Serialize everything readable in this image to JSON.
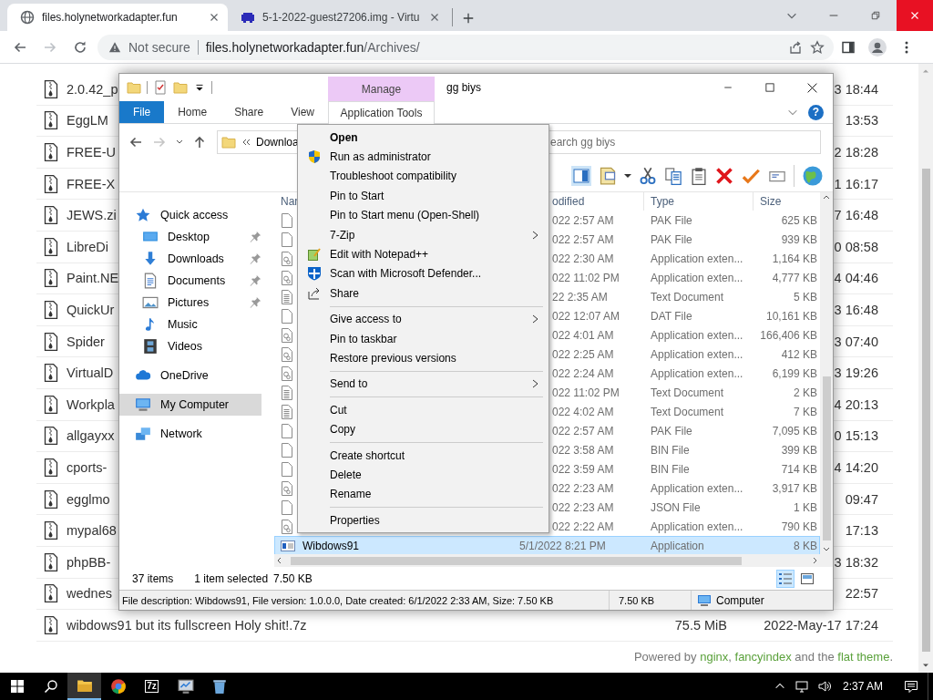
{
  "browser": {
    "tabs": [
      {
        "kind": "site",
        "title": "files.holynetworkadapter.fun",
        "selected": true
      },
      {
        "kind": "app",
        "title": "5-1-2022-guest27206.img - Virtu",
        "selected": false
      }
    ],
    "address": {
      "security": "Not secure",
      "host": "files.holynetworkadapter.fun",
      "path": "/Archives/"
    }
  },
  "listing": {
    "rows": [
      {
        "name": "2.0.42_p",
        "date": "3 18:44"
      },
      {
        "name": "EggLM",
        "date": "13:53"
      },
      {
        "name": "FREE-U",
        "date": "2 18:28"
      },
      {
        "name": "FREE-X",
        "date": "1 16:17"
      },
      {
        "name": "JEWS.zi",
        "date": "7 16:48"
      },
      {
        "name": "LibreDi",
        "date": "0 08:58"
      },
      {
        "name": "Paint.NE",
        "date": "4 04:46"
      },
      {
        "name": "QuickUr",
        "date": "3 16:48"
      },
      {
        "name": "Spider",
        "date": "3 07:40"
      },
      {
        "name": "VirtualD",
        "date": "3 19:26"
      },
      {
        "name": "Workpla",
        "date": "4 20:13"
      },
      {
        "name": "allgayxx",
        "date": "0 15:13"
      },
      {
        "name": "cports-",
        "date": "4 14:20"
      },
      {
        "name": "egglmo",
        "date": "09:47"
      },
      {
        "name": "mypal68",
        "date": "17:13"
      },
      {
        "name": "phpBB-",
        "date": "3 18:32"
      },
      {
        "name": "wednes",
        "date": "22:57"
      },
      {
        "name": "wibdows91 but its fullscreen Holy shit!.7z",
        "size": "75.5 MiB",
        "date": "2022-May-17 17:24"
      }
    ],
    "footer": [
      {
        "kind": "text",
        "text": "Powered by "
      },
      {
        "kind": "link",
        "text": "nginx"
      },
      {
        "kind": "text",
        "text": ", "
      },
      {
        "kind": "link",
        "text": "fancyindex"
      },
      {
        "kind": "text",
        "text": " and the "
      },
      {
        "kind": "link",
        "text": "flat theme"
      },
      {
        "kind": "text",
        "text": "."
      }
    ]
  },
  "explorer": {
    "title": "gg biys",
    "context_tab": {
      "group": "Manage",
      "label": "Application Tools",
      "selected": true
    },
    "ribbon_tabs": [
      {
        "kind": "file",
        "label": "File",
        "selected": false
      },
      {
        "kind": "tab",
        "label": "Home",
        "selected": false
      },
      {
        "kind": "tab",
        "label": "Share",
        "selected": false
      },
      {
        "kind": "tab",
        "label": "View",
        "selected": false
      }
    ],
    "help": "?",
    "address": {
      "crumb": "Downloa"
    },
    "search": {
      "placeholder": "earch gg biys"
    },
    "nav": [
      {
        "kind": "star",
        "label": "Quick access",
        "selected": false,
        "children": [
          {
            "kind": "desktop",
            "label": "Desktop",
            "pinned": true,
            "selected": false
          },
          {
            "kind": "download",
            "label": "Downloads",
            "pinned": true,
            "selected": false
          },
          {
            "kind": "documents",
            "label": "Documents",
            "pinned": true,
            "selected": false
          },
          {
            "kind": "pictures",
            "label": "Pictures",
            "pinned": true,
            "selected": false
          },
          {
            "kind": "music",
            "label": "Music",
            "pinned": false,
            "selected": false
          },
          {
            "kind": "videos",
            "label": "Videos",
            "pinned": false,
            "selected": false
          }
        ]
      },
      {
        "kind": "cloud",
        "label": "OneDrive",
        "selected": false
      },
      {
        "kind": "computer",
        "label": "My Computer",
        "selected": true
      },
      {
        "kind": "network",
        "label": "Network",
        "selected": false
      }
    ],
    "columns": [
      "Nar",
      "odified",
      "Type",
      "Size"
    ],
    "files": [
      {
        "kind": "blank",
        "modified": "022 2:57 AM",
        "type": "PAK File",
        "size": "625 KB",
        "selected": false
      },
      {
        "kind": "blank",
        "modified": "022 2:57 AM",
        "type": "PAK File",
        "size": "939 KB",
        "selected": false
      },
      {
        "kind": "ext",
        "modified": "022 2:30 AM",
        "type": "Application exten...",
        "size": "1,164 KB",
        "selected": false
      },
      {
        "kind": "ext",
        "modified": "022 11:02 PM",
        "type": "Application exten...",
        "size": "4,777 KB",
        "selected": false
      },
      {
        "kind": "text",
        "modified": "22 2:35 AM",
        "type": "Text Document",
        "size": "5 KB",
        "selected": false
      },
      {
        "kind": "blank",
        "modified": "022 12:07 AM",
        "type": "DAT File",
        "size": "10,161 KB",
        "selected": false
      },
      {
        "kind": "ext",
        "modified": "022 4:01 AM",
        "type": "Application exten...",
        "size": "166,406 KB",
        "selected": false
      },
      {
        "kind": "ext",
        "modified": "022 2:25 AM",
        "type": "Application exten...",
        "size": "412 KB",
        "selected": false
      },
      {
        "kind": "ext",
        "modified": "022 2:24 AM",
        "type": "Application exten...",
        "size": "6,199 KB",
        "selected": false
      },
      {
        "kind": "text",
        "modified": "022 11:02 PM",
        "type": "Text Document",
        "size": "2 KB",
        "selected": false
      },
      {
        "kind": "text",
        "modified": "022 4:02 AM",
        "type": "Text Document",
        "size": "7 KB",
        "selected": false
      },
      {
        "kind": "blank",
        "modified": "022 2:57 AM",
        "type": "PAK File",
        "size": "7,095 KB",
        "selected": false
      },
      {
        "kind": "blank",
        "modified": "022 3:58 AM",
        "type": "BIN File",
        "size": "399 KB",
        "selected": false
      },
      {
        "kind": "blank",
        "modified": "022 3:59 AM",
        "type": "BIN File",
        "size": "714 KB",
        "selected": false
      },
      {
        "kind": "ext",
        "modified": "022 2:23 AM",
        "type": "Application exten...",
        "size": "3,917 KB",
        "selected": false
      },
      {
        "kind": "blank",
        "modified": "022 2:23 AM",
        "type": "JSON File",
        "size": "1 KB",
        "selected": false
      },
      {
        "kind": "ext",
        "modified": "022 2:22 AM",
        "type": "Application exten...",
        "size": "790 KB",
        "selected": false
      },
      {
        "kind": "app",
        "name": "Wibdows91",
        "modified": "5/1/2022 8:21 PM",
        "type": "Application",
        "size": "8 KB",
        "selected": true
      }
    ],
    "status": {
      "count": "37 items",
      "selection": "1 item selected",
      "selection_size": "7.50 KB",
      "views": [
        {
          "kind": "details",
          "selected": true
        },
        {
          "kind": "tiles",
          "selected": false
        }
      ]
    },
    "details": {
      "description": "File description: Wibdows91, File version: 1.0.0.0, Date created: 6/1/2022 2:33 AM, Size: 7.50 KB",
      "size": "7.50 KB",
      "location": "Computer"
    }
  },
  "context_menu": [
    {
      "kind": "default",
      "label": "Open"
    },
    {
      "kind": "shield",
      "label": "Run as administrator"
    },
    {
      "kind": "plain",
      "label": "Troubleshoot compatibility"
    },
    {
      "kind": "plain",
      "label": "Pin to Start"
    },
    {
      "kind": "plain",
      "label": "Pin to Start menu (Open-Shell)"
    },
    {
      "kind": "submenu",
      "label": "7-Zip"
    },
    {
      "kind": "notepad",
      "label": "Edit with Notepad++"
    },
    {
      "kind": "defender",
      "label": "Scan with Microsoft Defender..."
    },
    {
      "kind": "share",
      "label": "Share"
    },
    {
      "kind": "separator"
    },
    {
      "kind": "submenu",
      "label": "Give access to"
    },
    {
      "kind": "plain",
      "label": "Pin to taskbar"
    },
    {
      "kind": "plain",
      "label": "Restore previous versions"
    },
    {
      "kind": "separator"
    },
    {
      "kind": "submenu",
      "label": "Send to"
    },
    {
      "kind": "separator"
    },
    {
      "kind": "plain",
      "label": "Cut"
    },
    {
      "kind": "plain",
      "label": "Copy"
    },
    {
      "kind": "separator"
    },
    {
      "kind": "plain",
      "label": "Create shortcut"
    },
    {
      "kind": "plain",
      "label": "Delete"
    },
    {
      "kind": "plain",
      "label": "Rename"
    },
    {
      "kind": "separator"
    },
    {
      "kind": "plain",
      "label": "Properties"
    }
  ],
  "taskbar": {
    "apps": [
      {
        "kind": "explorer",
        "active": true
      },
      {
        "kind": "chrome",
        "active": false
      },
      {
        "kind": "sevenzip",
        "label": "7z",
        "active": false
      },
      {
        "kind": "monitor",
        "active": false
      },
      {
        "kind": "bin",
        "active": false
      }
    ],
    "clock": "2:37 AM"
  }
}
